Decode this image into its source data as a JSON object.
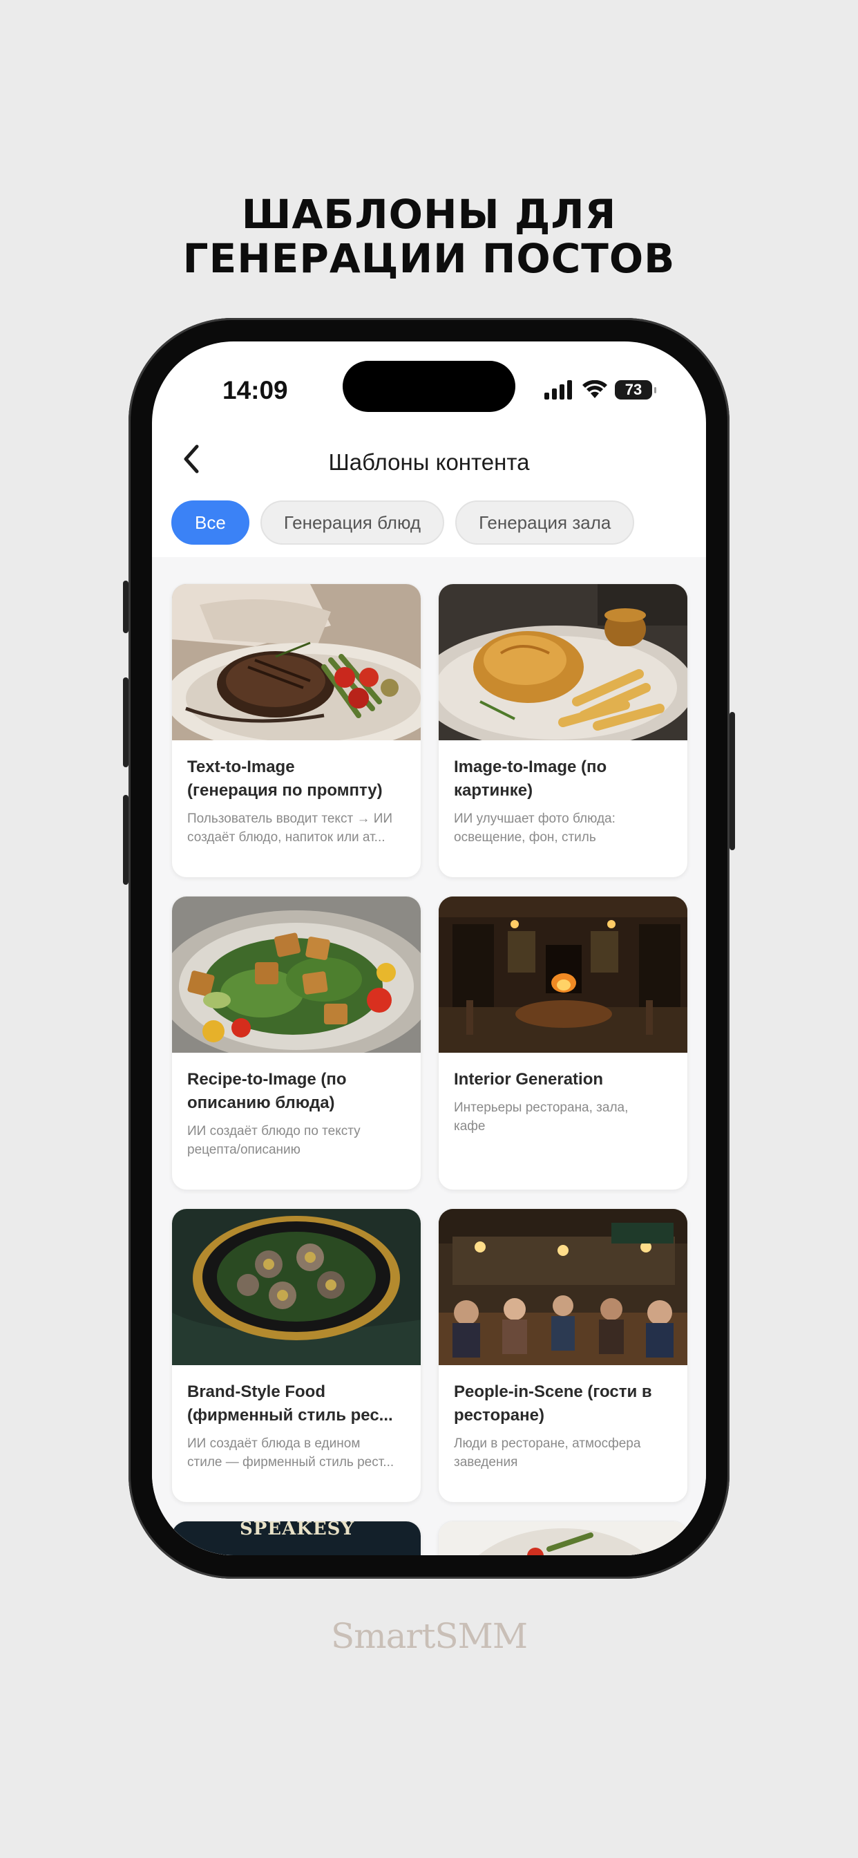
{
  "headline": {
    "line1": "ШАБЛОНЫ ДЛЯ",
    "line2": "ГЕНЕРАЦИИ ПОСТОВ"
  },
  "brand": "SmartSMM",
  "status_bar": {
    "time": "14:09",
    "battery": "73",
    "icons": [
      "signal-icon",
      "wifi-icon",
      "battery-icon"
    ]
  },
  "nav": {
    "back_icon": "chevron-left-icon",
    "title": "Шаблоны контента"
  },
  "filters": [
    {
      "label": "Все",
      "selected": true
    },
    {
      "label": "Генерация блюд",
      "selected": false
    },
    {
      "label": "Генерация зала",
      "selected": false
    }
  ],
  "templates": [
    {
      "title_l1": "Text-to-Image",
      "title_l2": "(генерация по промпту)",
      "desc_l1": "Пользователь вводит текст → ИИ",
      "desc_l2": "создаёт блюдо, напиток или ат..."
    },
    {
      "title_l1": "Image-to-Image (по",
      "title_l2": "картинке)",
      "desc_l1": "ИИ улучшает фото блюда:",
      "desc_l2": "освещение, фон, стиль"
    },
    {
      "title_l1": "Recipe-to-Image (по",
      "title_l2": "описанию блюда)",
      "desc_l1": "ИИ создаёт блюдо по тексту",
      "desc_l2": "рецепта/описанию"
    },
    {
      "title_l1": "Interior Generation",
      "title_l2": "",
      "desc_l1": "Интерьеры ресторана, зала,",
      "desc_l2": "кафе"
    },
    {
      "title_l1": "Brand-Style Food",
      "title_l2": "(фирменный стиль рес...",
      "desc_l1": "ИИ создаёт блюда в едином",
      "desc_l2": "стиле — фирменный стиль рест..."
    },
    {
      "title_l1": "People-in-Scene (гости в",
      "title_l2": "ресторане)",
      "desc_l1": "Люди в ресторане, атмосфера",
      "desc_l2": "заведения"
    },
    {
      "title_l1": "",
      "title_l2": "",
      "desc_l1": "",
      "desc_l2": "",
      "image_text": "SPEAKESY"
    },
    {
      "title_l1": "",
      "title_l2": "",
      "desc_l1": "",
      "desc_l2": ""
    }
  ]
}
